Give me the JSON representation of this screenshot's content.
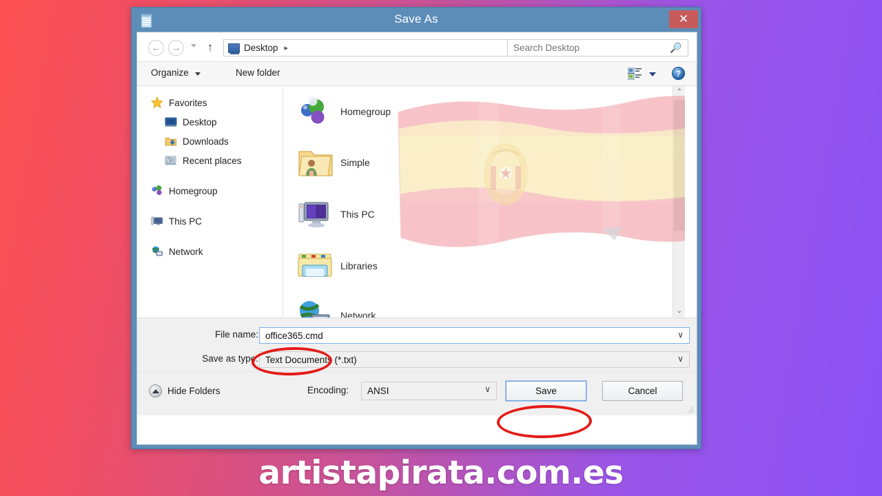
{
  "window": {
    "title": "Save As",
    "app_icon": "notepad-icon",
    "close_label": "✕"
  },
  "navigation": {
    "back_icon": "←",
    "forward_icon": "→",
    "history_dropdown_icon": "chevron-down-icon",
    "up_icon": "↑",
    "address": {
      "icon": "desktop-icon",
      "current": "Desktop",
      "separator": "▸",
      "dropdown_icon": "∨"
    },
    "refresh_icon": "↻",
    "search": {
      "placeholder": "Search Desktop",
      "value": "",
      "icon": "search-icon"
    }
  },
  "toolbar": {
    "organize_label": "Organize",
    "organize_caret": "caret-down-icon",
    "new_folder_label": "New folder",
    "view_icon": "view-options-icon",
    "view_caret": "caret-down-icon",
    "help_icon": "?"
  },
  "sidebar": {
    "items": [
      {
        "label": "Favorites",
        "icon": "star-icon",
        "level": "root"
      },
      {
        "label": "Desktop",
        "icon": "desktop-icon",
        "level": "child"
      },
      {
        "label": "Downloads",
        "icon": "downloads-icon",
        "level": "child"
      },
      {
        "label": "Recent places",
        "icon": "recent-places-icon",
        "level": "child"
      },
      {
        "label": "Homegroup",
        "icon": "homegroup-icon",
        "level": "root"
      },
      {
        "label": "This PC",
        "icon": "computer-icon",
        "level": "root"
      },
      {
        "label": "Network",
        "icon": "network-icon",
        "level": "root"
      }
    ]
  },
  "filelist": {
    "items": [
      {
        "label": "Homegroup",
        "icon": "homegroup-icon"
      },
      {
        "label": "Simple",
        "icon": "folder-user-icon"
      },
      {
        "label": "This PC",
        "icon": "computer-icon"
      },
      {
        "label": "Libraries",
        "icon": "libraries-icon"
      },
      {
        "label": "Network",
        "icon": "network-icon"
      }
    ],
    "overlay": "spain-flag-watermark",
    "scrollbar": {
      "up_icon": "⌃",
      "down_icon": "⌄"
    }
  },
  "form": {
    "file_name_label": "File name:",
    "file_name_value": "office365.cmd",
    "file_name_caret": "∨",
    "save_as_type_label": "Save as type:",
    "save_as_type_value": "Text Documents (*.txt)",
    "save_as_type_caret": "∨"
  },
  "footer": {
    "hide_folders_label": "Hide Folders",
    "hide_folders_icon": "collapse-up-icon",
    "encoding_label": "Encoding:",
    "encoding_value": "ANSI",
    "encoding_caret": "∨",
    "save_label": "Save",
    "cancel_label": "Cancel"
  },
  "annotations": {
    "color": "#e41b17",
    "highlight_filename": "office365.cmd",
    "highlight_button": "Save"
  },
  "watermark": {
    "text": "artistapirata.com.es"
  },
  "colors": {
    "titlebar": "#5b8db8",
    "close_button": "#c75b5b",
    "background_left": "#fb5051",
    "background_right": "#8b51f5",
    "annotation_red": "#e41b17"
  }
}
